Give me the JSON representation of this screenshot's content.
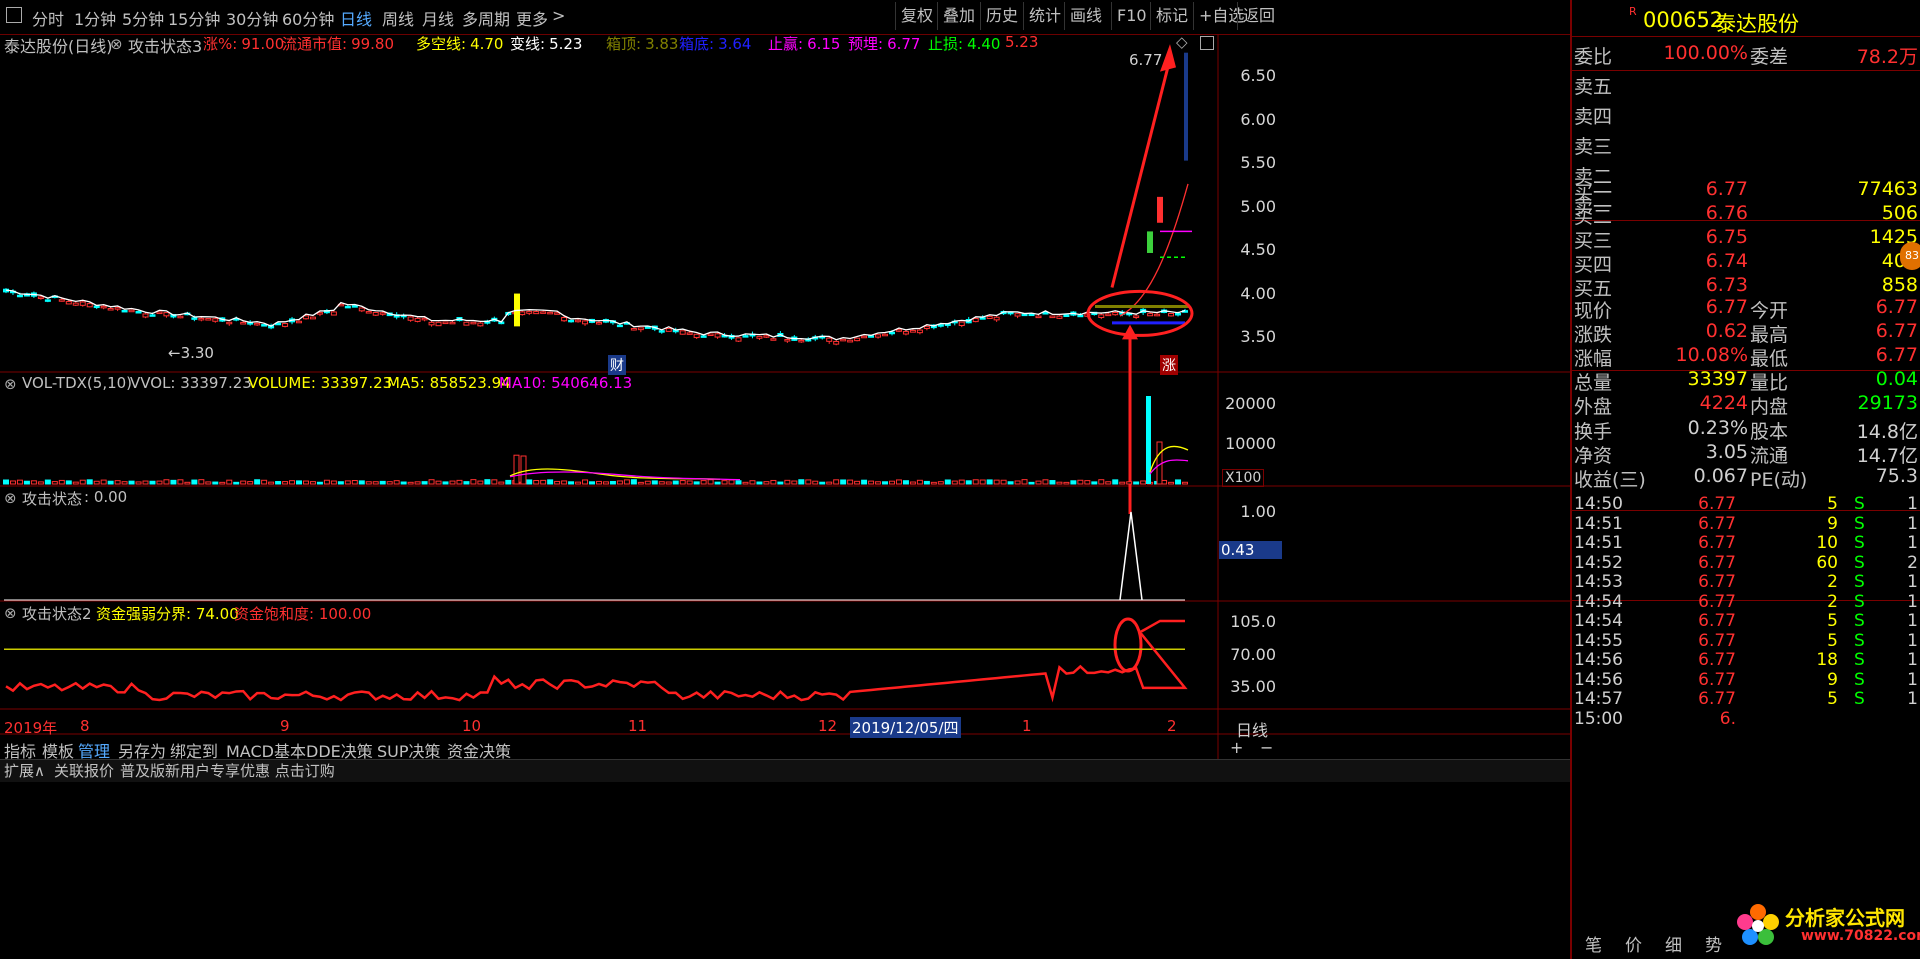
{
  "toolbar": {
    "periods": [
      "分时",
      "1分钟",
      "5分钟",
      "15分钟",
      "30分钟",
      "60分钟",
      "日线",
      "周线",
      "月线",
      "多周期",
      "更多"
    ],
    "actions": [
      "复权",
      "叠加",
      "历史",
      "统计",
      "画线",
      "F10",
      "标记",
      "+自选",
      "返回"
    ]
  },
  "chart_header": {
    "stock": "泰达股份(日线)",
    "indicator": "攻击状态3",
    "items": [
      {
        "label": "涨%:",
        "value": "91.00",
        "color": "#ff3030"
      },
      {
        "label": "流通市值:",
        "value": "99.80",
        "color": "#ff3030"
      },
      {
        "label": "多空线:",
        "value": "4.70",
        "color": "#ffff00"
      },
      {
        "label": "变线:",
        "value": "5.23",
        "color": "#ffffff"
      },
      {
        "label": "箱顶:",
        "value": "3.83",
        "color": "#808000"
      },
      {
        "label": "箱底:",
        "value": "3.64",
        "color": "#2020ff"
      },
      {
        "label": "止赢:",
        "value": "6.15",
        "color": "#ff00ff"
      },
      {
        "label": "预埋:",
        "value": "6.77",
        "color": "#ff00ff"
      },
      {
        "label": "止损:",
        "value": "4.40",
        "color": "#00ff00"
      },
      {
        "label": "",
        "value": "5.23",
        "color": "#ff3030"
      }
    ]
  },
  "main_axis": [
    "6.50",
    "6.00",
    "5.50",
    "5.00",
    "4.50",
    "4.00",
    "3.50"
  ],
  "main_labels": {
    "high": "6.77",
    "low": "←3.30",
    "cai": "财",
    "zhang": "涨"
  },
  "vol_header": {
    "name": "VOL-TDX(5,10)",
    "vvol": "VVOL: 33397.23",
    "volume": "VOLUME: 33397.23",
    "ma5": "MA5: 858523.94",
    "ma10": "MA10: 540646.13"
  },
  "vol_axis": [
    "20000",
    "10000"
  ],
  "vol_unit": "X100",
  "attack_header": {
    "name": "攻击状态",
    "value": ": 0.00"
  },
  "attack_axis": [
    "1.00"
  ],
  "attack_cursor": "0.43",
  "attack2_header": {
    "name": "攻击状态2",
    "line1": "资金强弱分界: 74.00",
    "line2": "资金饱和度: 100.00"
  },
  "attack2_axis": [
    "105.0",
    "70.00",
    "35.00"
  ],
  "date_axis": {
    "labels": [
      "2019年",
      "8",
      "9",
      "10",
      "11",
      "12",
      "1",
      "2"
    ],
    "cursor": "2019/12/05/四",
    "period": "日线"
  },
  "bottom_tabs": [
    "指标",
    "模板",
    "管理",
    "另存为",
    "绑定到",
    "MACD基本",
    "DDE决策",
    "SUP决策",
    "资金决策"
  ],
  "status_bar": [
    "扩展∧",
    "关联报价",
    "普及版新用户专享优惠 点击订购"
  ],
  "right_bottom_tabs": [
    "笔",
    "价",
    "细",
    "势"
  ],
  "watermark": {
    "title": "分析家公式网",
    "url": "www.70822.com"
  },
  "quote": {
    "code": "000652",
    "name": "泰达股份",
    "weibi_label": "委比",
    "weibi": "100.00%",
    "weicha_label": "委差",
    "weicha": "78.2万",
    "asks": [
      {
        "label": "卖五"
      },
      {
        "label": "卖四"
      },
      {
        "label": "卖三"
      },
      {
        "label": "卖二"
      },
      {
        "label": "卖一"
      }
    ],
    "bids": [
      {
        "label": "买一",
        "price": "6.77",
        "vol": "77463"
      },
      {
        "label": "买二",
        "price": "6.76",
        "vol": "506"
      },
      {
        "label": "买三",
        "price": "6.75",
        "vol": "1425"
      },
      {
        "label": "买四",
        "price": "6.74",
        "vol": "408"
      },
      {
        "label": "买五",
        "price": "6.73",
        "vol": "858"
      }
    ],
    "stats": [
      {
        "l1": "现价",
        "v1": "6.77",
        "c1": "#ff3030",
        "l2": "今开",
        "v2": "6.77",
        "c2": "#ff3030"
      },
      {
        "l1": "涨跌",
        "v1": "0.62",
        "c1": "#ff3030",
        "l2": "最高",
        "v2": "6.77",
        "c2": "#ff3030"
      },
      {
        "l1": "涨幅",
        "v1": "10.08%",
        "c1": "#ff3030",
        "l2": "最低",
        "v2": "6.77",
        "c2": "#ff3030"
      },
      {
        "l1": "总量",
        "v1": "33397",
        "c1": "#ffff00",
        "l2": "量比",
        "v2": "0.04",
        "c2": "#00ff00"
      },
      {
        "l1": "外盘",
        "v1": "4224",
        "c1": "#ff3030",
        "l2": "内盘",
        "v2": "29173",
        "c2": "#00ff00"
      }
    ],
    "stats2": [
      {
        "l1": "换手",
        "v1": "0.23%",
        "l2": "股本",
        "v2": "14.8亿"
      },
      {
        "l1": "净资",
        "v1": "3.05",
        "l2": "流通",
        "v2": "14.7亿"
      },
      {
        "l1": "收益(三)",
        "v1": "0.067",
        "l2": "PE(动)",
        "v2": "75.3"
      }
    ],
    "ticks": [
      {
        "t": "14:50",
        "p": "6.77",
        "v": "5",
        "s": "S",
        "n": "1"
      },
      {
        "t": "14:51",
        "p": "6.77",
        "v": "9",
        "s": "S",
        "n": "1"
      },
      {
        "t": "14:51",
        "p": "6.77",
        "v": "10",
        "s": "S",
        "n": "1"
      },
      {
        "t": "14:52",
        "p": "6.77",
        "v": "60",
        "s": "S",
        "n": "2"
      },
      {
        "t": "14:53",
        "p": "6.77",
        "v": "2",
        "s": "S",
        "n": "1"
      },
      {
        "t": "14:54",
        "p": "6.77",
        "v": "2",
        "s": "S",
        "n": "1"
      },
      {
        "t": "14:54",
        "p": "6.77",
        "v": "5",
        "s": "S",
        "n": "1"
      },
      {
        "t": "14:55",
        "p": "6.77",
        "v": "5",
        "s": "S",
        "n": "1"
      },
      {
        "t": "14:56",
        "p": "6.77",
        "v": "18",
        "s": "S",
        "n": "1"
      },
      {
        "t": "14:56",
        "p": "6.77",
        "v": "9",
        "s": "S",
        "n": "1"
      },
      {
        "t": "14:57",
        "p": "6.77",
        "v": "5",
        "s": "S",
        "n": "1"
      },
      {
        "t": "15:00",
        "p": "6.",
        "v": "",
        "s": "",
        "n": ""
      }
    ]
  }
}
